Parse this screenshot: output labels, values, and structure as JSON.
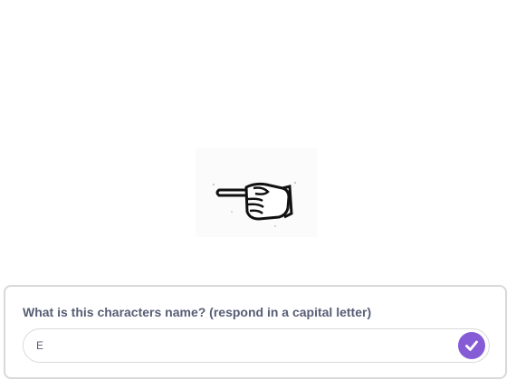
{
  "stage": {
    "sprite_icon": "pointing-hand-icon"
  },
  "ask": {
    "question": "What is this characters name? (respond in a capital letter)",
    "answer_value": "E",
    "submit_icon": "check-icon",
    "accent_color": "#855cd6",
    "text_color": "#575e75"
  }
}
